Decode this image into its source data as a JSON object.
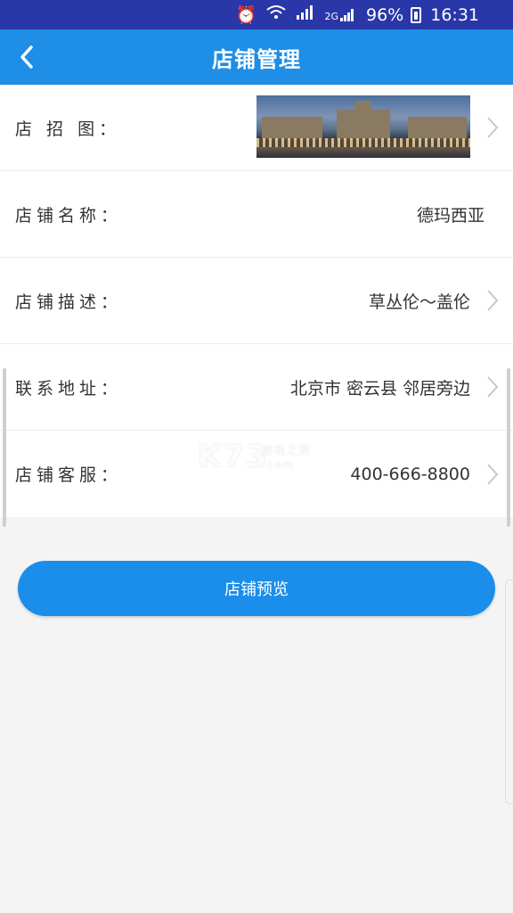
{
  "status_bar": {
    "battery": "96%",
    "time": "16:31",
    "network_label": "2G"
  },
  "header": {
    "title": "店铺管理"
  },
  "rows": [
    {
      "label": "店 招 图：",
      "value": ""
    },
    {
      "label": "店铺名称：",
      "value": "德玛西亚"
    },
    {
      "label": "店铺描述：",
      "value": "草丛伦～盖伦"
    },
    {
      "label": "联系地址：",
      "value": "北京市 密云县 邻居旁边"
    },
    {
      "label": "店铺客服：",
      "value": "400-666-8800"
    }
  ],
  "preview_button": "店铺预览",
  "watermark": {
    "main": "K73",
    "sub": "游戏之家",
    "domain": ".com"
  }
}
